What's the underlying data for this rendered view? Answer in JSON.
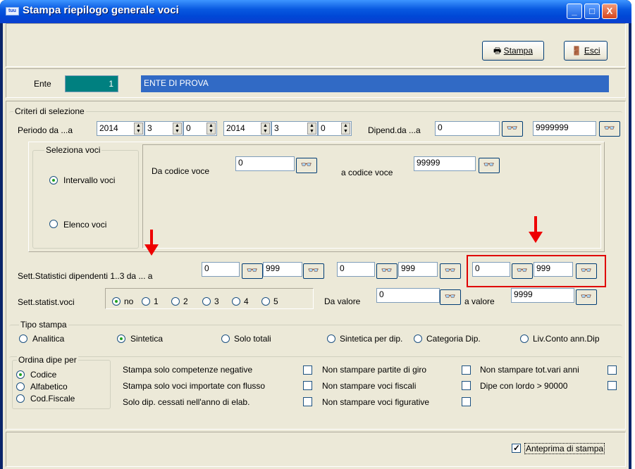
{
  "window": {
    "title": "Stampa riepilogo generale voci",
    "app_icon": "tuu",
    "minimize": "_",
    "maximize": "□",
    "close": "X"
  },
  "toolbar": {
    "stampa_label": "Stampa",
    "esci_label": "Esci",
    "print_icon": "🖶",
    "exit_icon": "🚪"
  },
  "ente": {
    "label": "Ente",
    "code": "1",
    "name": "ENTE DI PROVA"
  },
  "criteri": {
    "title": "Criteri di selezione",
    "periodo_label": "Periodo da ...a",
    "periodo": [
      "2014",
      "3",
      "0",
      "2014",
      "3",
      "0"
    ],
    "dipend_label": "Dipend.da ...a",
    "dipend_from": "0",
    "dipend_to": "9999999"
  },
  "voci": {
    "title": "Seleziona voci",
    "opt_intervallo": "Intervallo voci",
    "opt_elenco": "Elenco voci",
    "da_label": "Da codice voce",
    "da_value": "0",
    "a_label": "a codice voce",
    "a_value": "99999"
  },
  "sett": {
    "label": "Sett.Statistici dipendenti 1..3 da ... a",
    "pairs": [
      [
        "0",
        "999"
      ],
      [
        "0",
        "999"
      ],
      [
        "0",
        "999"
      ]
    ]
  },
  "settvoci": {
    "label": "Sett.statist.voci",
    "options": [
      "no",
      "1",
      "2",
      "3",
      "4",
      "5"
    ],
    "da_label": "Da valore",
    "da_value": "0",
    "a_label": "a valore",
    "a_value": "9999"
  },
  "tipo": {
    "title": "Tipo stampa",
    "options": [
      "Analitica",
      "Sintetica",
      "Solo totali",
      "Sintetica per dip.",
      "Categoria Dip.",
      "Liv.Conto ann.Dip"
    ]
  },
  "ordina": {
    "title": "Ordina dipe per",
    "options": [
      "Codice",
      "Alfabetico",
      "Cod.Fiscale"
    ]
  },
  "checks": {
    "col1": [
      "Stampa solo competenze negative",
      "Stampa solo voci importate con flusso",
      "Solo dip. cessati nell'anno di elab."
    ],
    "col2": [
      "Non stampare partite di giro",
      "Non stampare voci fiscali",
      "Non stampare voci figurative"
    ],
    "col3": [
      "Non stampare tot.vari anni",
      "Dipe con lordo > 90000"
    ]
  },
  "footer": {
    "anteprima_label": "Anteprima di stampa"
  },
  "icons": {
    "glasses": "👓"
  },
  "colors": {
    "ente_code_bg": "#008080",
    "ente_name_bg": "#316ac5",
    "highlight": "#e00000"
  }
}
